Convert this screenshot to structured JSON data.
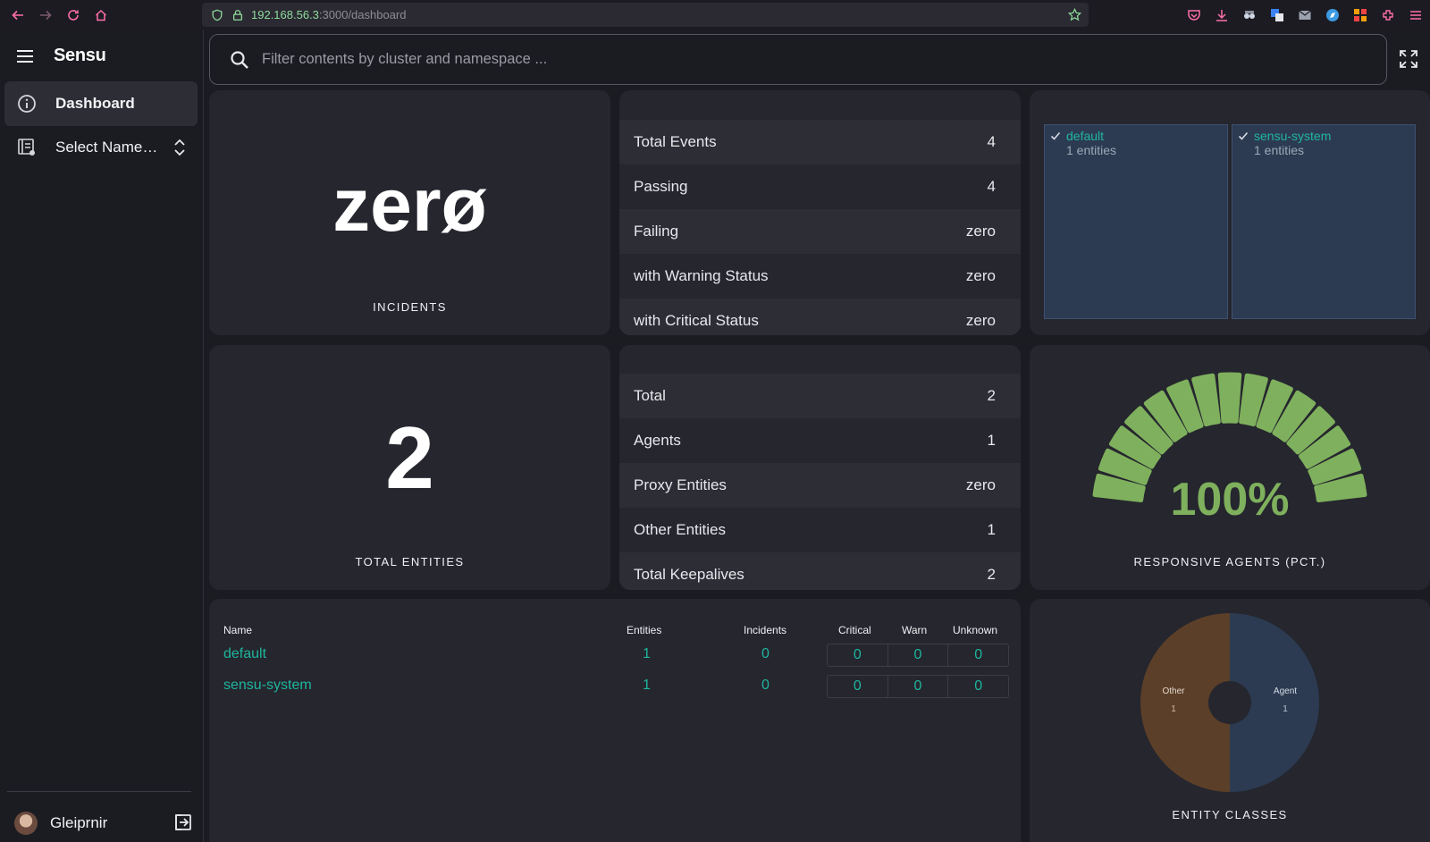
{
  "browser": {
    "url_host": "192.168.56.3",
    "url_rest": ":3000/dashboard"
  },
  "sidebar": {
    "brand": "Sensu",
    "items": [
      {
        "label": "Dashboard",
        "icon": "info-icon",
        "active": true
      },
      {
        "label": "Select Name…",
        "icon": "namespace-icon",
        "active": false
      }
    ],
    "user": "Gleiprnir"
  },
  "search": {
    "placeholder": "Filter contents by cluster and namespace ..."
  },
  "incidents": {
    "value": "zerø",
    "caption": "INCIDENTS"
  },
  "events": {
    "rows": [
      {
        "label": "Total Events",
        "value": "4"
      },
      {
        "label": "Passing",
        "value": "4"
      },
      {
        "label": "Failing",
        "value": "zero"
      },
      {
        "label": "with Warning Status",
        "value": "zero"
      },
      {
        "label": "with Critical Status",
        "value": "zero"
      }
    ]
  },
  "namespaces_tree": [
    {
      "name": "default",
      "count": "1 entities"
    },
    {
      "name": "sensu-system",
      "count": "1 entities"
    }
  ],
  "entities": {
    "value": "2",
    "caption": "TOTAL ENTITIES",
    "rows": [
      {
        "label": "Total",
        "value": "2"
      },
      {
        "label": "Agents",
        "value": "1"
      },
      {
        "label": "Proxy Entities",
        "value": "zero"
      },
      {
        "label": "Other Entities",
        "value": "1"
      },
      {
        "label": "Total Keepalives",
        "value": "2"
      }
    ]
  },
  "gauge": {
    "value": "100%",
    "fraction": 1.0,
    "caption": "RESPONSIVE AGENTS (PCT.)",
    "color": "#7fb05d"
  },
  "table": {
    "headers": {
      "name": "Name",
      "entities": "Entities",
      "incidents": "Incidents",
      "critical": "Critical",
      "warn": "Warn",
      "unknown": "Unknown"
    },
    "rows": [
      {
        "name": "default",
        "entities": "1",
        "incidents": "0",
        "critical": "0",
        "warn": "0",
        "unknown": "0"
      },
      {
        "name": "sensu-system",
        "entities": "1",
        "incidents": "0",
        "critical": "0",
        "warn": "0",
        "unknown": "0"
      }
    ]
  },
  "entity_classes": {
    "caption": "ENTITY CLASSES",
    "slices": [
      {
        "label": "Other",
        "value": "1",
        "color": "#5c3f28"
      },
      {
        "label": "Agent",
        "value": "1",
        "color": "#2c3b52"
      }
    ]
  }
}
